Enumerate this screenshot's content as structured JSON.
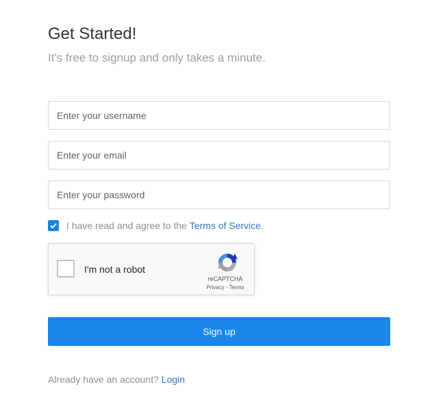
{
  "header": {
    "title": "Get Started!",
    "subtitle": "It's free to signup and only takes a minute."
  },
  "form": {
    "username_placeholder": "Enter your username",
    "email_placeholder": "Enter your email",
    "password_placeholder": "Enter your password",
    "username_value": "",
    "email_value": "",
    "password_value": "",
    "terms": {
      "checked": true,
      "text": "I have read and agree to the",
      "link_text": "Terms of Service",
      "suffix": "."
    },
    "signup_label": "Sign up"
  },
  "captcha": {
    "label": "I'm not a robot",
    "brand": "reCAPTCHA",
    "privacy": "Privacy",
    "separator": " - ",
    "terms": "Terms",
    "checked": false
  },
  "footer": {
    "text": "Already have an account?",
    "login_text": "Login"
  },
  "colors": {
    "accent": "#1a86e8",
    "link": "#2f78c4",
    "muted_text": "#8a8f94"
  },
  "icons": {
    "terms_checkbox": "checkmark-icon",
    "captcha_logo": "recaptcha-logo-icon"
  }
}
